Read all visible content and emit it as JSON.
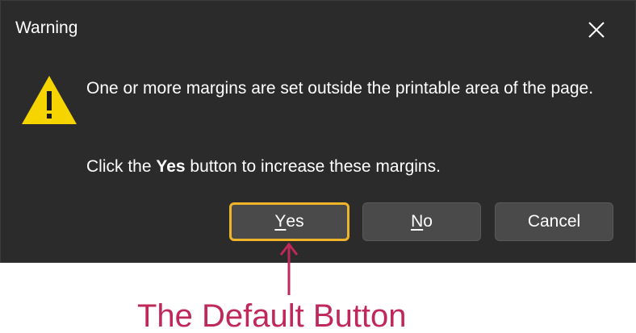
{
  "dialog": {
    "title": "Warning",
    "message_line1": "One or more margins are set outside the printable area of the page.",
    "message_line2_prefix": "Click the ",
    "message_line2_bold": "Yes",
    "message_line2_suffix": " button to increase these margins.",
    "icons": {
      "warning": "warning-triangle-icon",
      "close": "close-icon"
    }
  },
  "buttons": {
    "yes": {
      "mnemonic": "Y",
      "rest": "es"
    },
    "no": {
      "mnemonic": "N",
      "rest": "o"
    },
    "cancel": "Cancel"
  },
  "annotation": {
    "text": "The Default Button",
    "color": "#c0285a"
  },
  "colors": {
    "dialog_bg": "#2b2b2b",
    "button_bg": "#4a4a4a",
    "default_focus_border": "#f0b429",
    "warning_yellow": "#f5d400"
  }
}
